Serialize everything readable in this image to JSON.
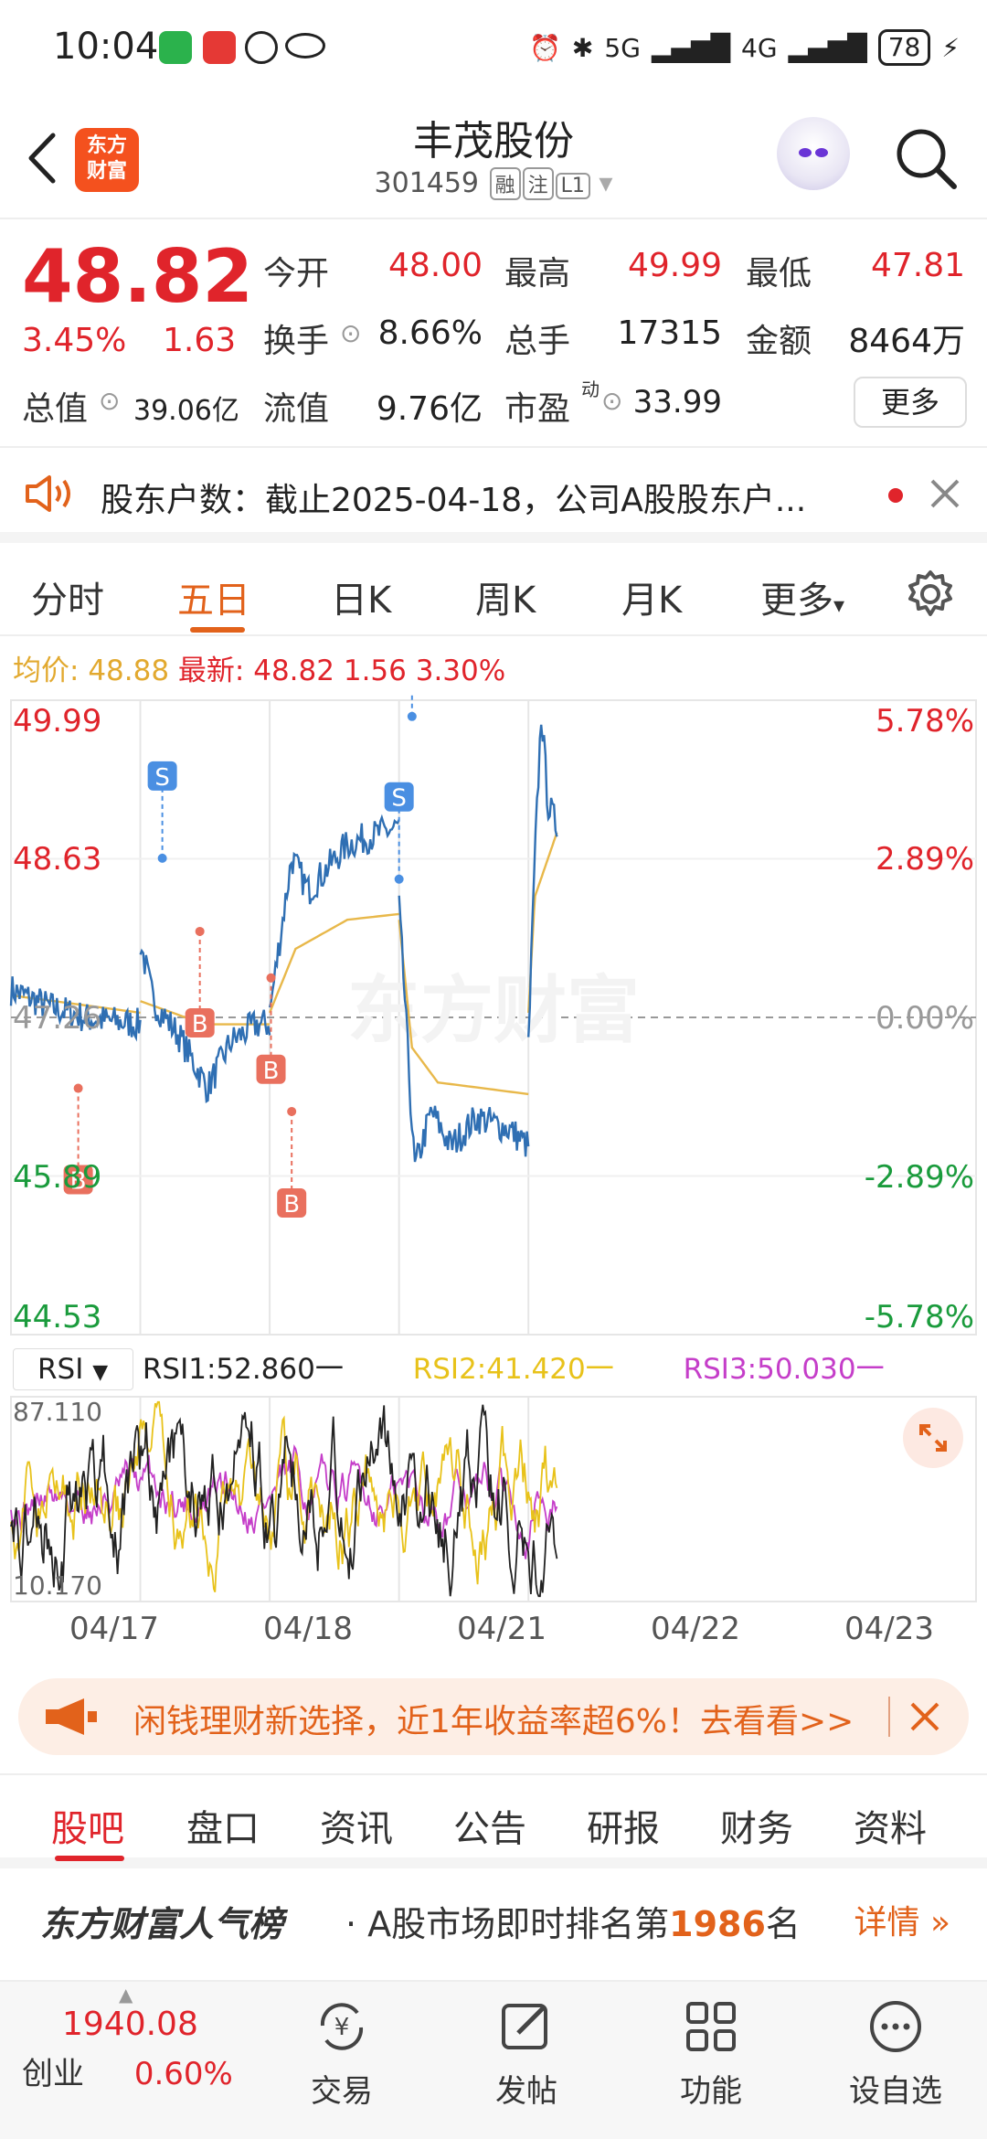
{
  "status_bar": {
    "time": "10:04",
    "battery": "78",
    "signal_labels": [
      "5G",
      "4G"
    ]
  },
  "header": {
    "stock_name": "丰茂股份",
    "stock_code": "301459",
    "tags": [
      "融",
      "注",
      "L1"
    ],
    "logo_text_1": "东方",
    "logo_text_2": "财富"
  },
  "quote": {
    "price": "48.82",
    "change_pct": "3.45%",
    "change": "1.63",
    "open_label": "今开",
    "open": "48.00",
    "high_label": "最高",
    "high": "49.99",
    "low_label": "最低",
    "low": "47.81",
    "turnover_label": "换手",
    "turnover": "8.66%",
    "volume_label": "总手",
    "volume": "17315",
    "amount_label": "金额",
    "amount": "8464万",
    "total_mv_label": "总值",
    "total_mv": "39.06亿",
    "float_mv_label": "流值",
    "float_mv": "9.76亿",
    "pe_label": "市盈",
    "pe_sup": "动",
    "pe": "33.99",
    "more_label": "更多"
  },
  "notice": {
    "text": "股东户数：截止2025-04-18，公司A股股东户..."
  },
  "chart_tabs": {
    "items": [
      "分时",
      "五日",
      "日K",
      "周K",
      "月K",
      "更多"
    ],
    "active": "五日"
  },
  "avg_row": {
    "avg_label": "均价:",
    "avg_value": "48.88",
    "latest_label": "最新:",
    "latest_value": "48.82",
    "latest_change": "1.56",
    "latest_pct": "3.30%"
  },
  "chart_data": [
    {
      "type": "line",
      "title": "",
      "x_categories": [
        "04/17",
        "04/18",
        "04/21",
        "04/22",
        "04/23"
      ],
      "y_left_ticks": [
        "49.99",
        "48.63",
        "47.26",
        "45.89",
        "44.53"
      ],
      "y_right_ticks": [
        "5.78%",
        "2.89%",
        "0.00%",
        "-2.89%",
        "-5.78%"
      ],
      "ylim": [
        44.53,
        49.99
      ],
      "baseline": 47.26,
      "series": [],
      "markers": [
        {
          "label": "B",
          "day": 0,
          "pos": 0.52,
          "price": 46.65
        },
        {
          "label": "S",
          "day": 1,
          "pos": 0.17,
          "price": 48.63
        },
        {
          "label": "B",
          "day": 1,
          "pos": 0.46,
          "price": 48.0
        },
        {
          "label": "B",
          "day": 2,
          "pos": 0.01,
          "price": 47.6
        },
        {
          "label": "B",
          "day": 2,
          "pos": 0.17,
          "price": 46.45
        },
        {
          "label": "S",
          "day": 3,
          "pos": 0.0,
          "price": 48.45
        },
        {
          "label": "S",
          "day": 3,
          "pos": 0.1,
          "price": 49.85
        }
      ]
    },
    {
      "type": "line",
      "title": "",
      "indicator": "RSI",
      "ylim": [
        10.17,
        87.11
      ],
      "y_ticks": [
        "87.110",
        "10.170"
      ],
      "series": [
        {
          "name": "RSI1",
          "last": 52.86,
          "color": "#222222"
        },
        {
          "name": "RSI2",
          "last": 41.42,
          "color": "#e8c21a"
        },
        {
          "name": "RSI3",
          "last": 50.03,
          "color": "#c53ec9"
        }
      ]
    }
  ],
  "rsi_header": {
    "select": "RSI",
    "rsi1": "RSI1:52.860一",
    "rsi2": "RSI2:41.420一",
    "rsi3": "RSI3:50.030一"
  },
  "banner": {
    "text": "闲钱理财新选择，近1年收益率超6%！去看看>>"
  },
  "sub_tabs": {
    "items": [
      "股吧",
      "盘口",
      "资讯",
      "公告",
      "研报",
      "财务",
      "资料"
    ],
    "active": "股吧"
  },
  "rank": {
    "brand": "东方财富人气榜",
    "text_prefix": "· A股市场即时排名第",
    "rank": "1986",
    "text_suffix": "名",
    "detail": "详情"
  },
  "bottom_nav": {
    "index_value": "1940.08",
    "index_name": "创业",
    "index_pct": "0.60%",
    "items": [
      "交易",
      "发帖",
      "功能",
      "设自选"
    ]
  },
  "colors": {
    "up": "#e0242b",
    "down": "#1a9b3c",
    "accent": "#e2621b",
    "price_line": "#2f6fb3",
    "avg_line": "#e8b84a"
  }
}
